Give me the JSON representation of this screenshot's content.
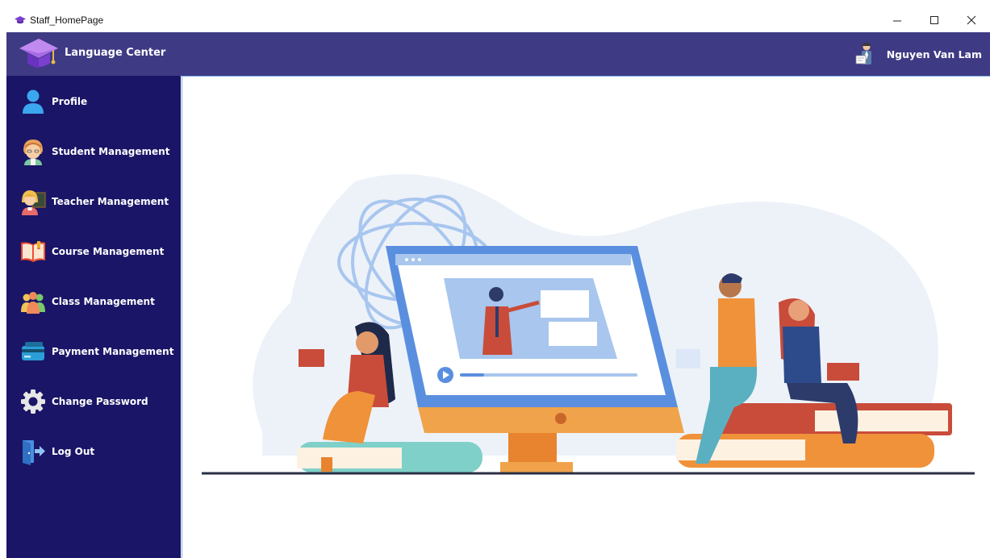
{
  "window": {
    "title": "Staff_HomePage",
    "icon": "graduation-cap-icon"
  },
  "header": {
    "brand": "Language Center",
    "user_name": "Nguyen Van Lam",
    "background": "#3e3a84"
  },
  "sidebar": {
    "background": "#1a1567",
    "items": [
      {
        "label": "Profile",
        "icon": "user-icon"
      },
      {
        "label": "Student Management",
        "icon": "student-icon"
      },
      {
        "label": "Teacher Management",
        "icon": "teacher-icon"
      },
      {
        "label": "Course Management",
        "icon": "book-icon"
      },
      {
        "label": "Class Management",
        "icon": "people-group-icon"
      },
      {
        "label": "Payment Management",
        "icon": "credit-card-icon"
      },
      {
        "label": "Change Password",
        "icon": "gear-icon"
      },
      {
        "label": "Log Out",
        "icon": "logout-icon"
      }
    ]
  },
  "content": {
    "illustration": "online-learning-illustration",
    "border_color": "#7fb1e8"
  }
}
